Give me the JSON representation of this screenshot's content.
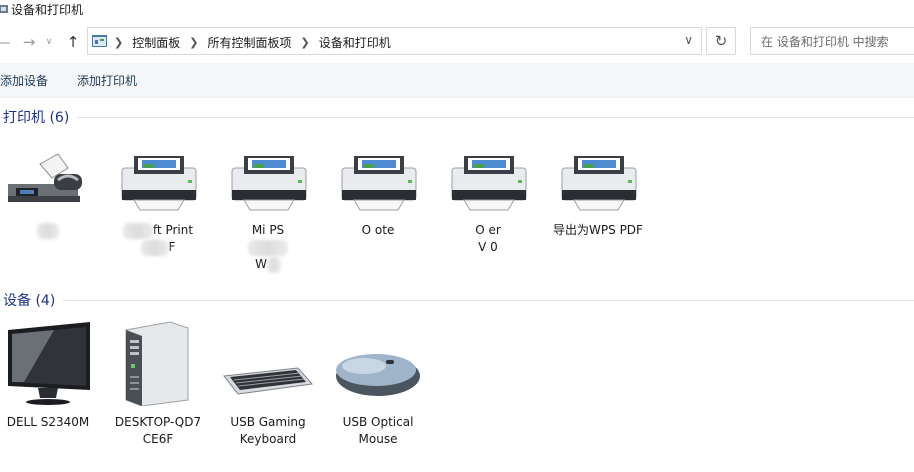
{
  "window": {
    "title": "设备和打印机"
  },
  "nav": {
    "breadcrumbs": [
      "控制面板",
      "所有控制面板项",
      "设备和打印机"
    ],
    "search_placeholder": "在 设备和打印机 中搜索"
  },
  "commands": {
    "add_device": "添加设备",
    "add_printer": "添加打印机"
  },
  "groups": {
    "printers": {
      "title": "打印机 (6)",
      "items": [
        {
          "icon": "fax-icon",
          "label": ""
        },
        {
          "icon": "printer-icon",
          "label_visible": "ft Print",
          "label_line2_visible": "F"
        },
        {
          "icon": "printer-icon",
          "label_visible": "Mi            PS",
          "label_line2_visible": "W"
        },
        {
          "icon": "printer-icon",
          "label_visible": "O          ote"
        },
        {
          "icon": "printer-icon",
          "label_visible": "O          er",
          "label_line2_visible": "V           0"
        },
        {
          "icon": "printer-icon",
          "label": "导出为WPS PDF"
        }
      ]
    },
    "devices": {
      "title": "设备 (4)",
      "items": [
        {
          "icon": "monitor-icon",
          "label": "DELL S2340M"
        },
        {
          "icon": "computer-tower-icon",
          "label": "DESKTOP-QD7 CE6F"
        },
        {
          "icon": "keyboard-icon",
          "label": "USB Gaming Keyboard"
        },
        {
          "icon": "mouse-icon",
          "label": "USB Optical Mouse"
        }
      ]
    }
  },
  "colors": {
    "group_title": "#1e3287",
    "command_text": "#1e3a5a",
    "command_bar_bg": "#f5f6f7"
  }
}
